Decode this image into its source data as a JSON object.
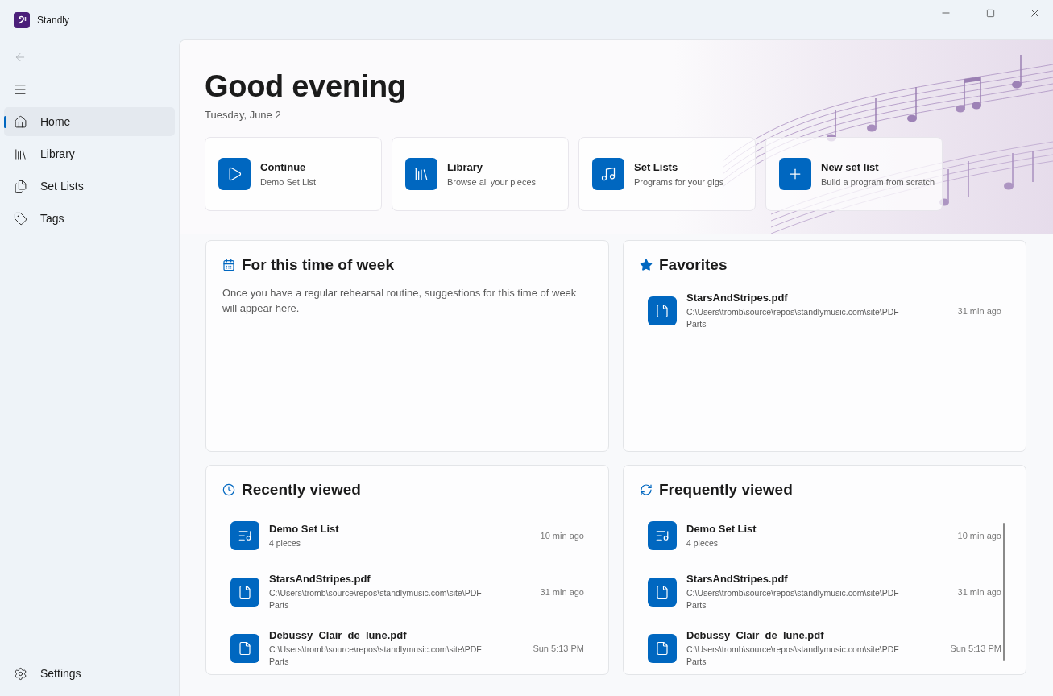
{
  "window": {
    "title": "Standly"
  },
  "nav": {
    "items": [
      {
        "label": "Home",
        "selected": true
      },
      {
        "label": "Library",
        "selected": false
      },
      {
        "label": "Set Lists",
        "selected": false
      },
      {
        "label": "Tags",
        "selected": false
      }
    ],
    "footer": {
      "label": "Settings"
    }
  },
  "hero": {
    "greeting": "Good evening",
    "date": "Tuesday, June 2",
    "actions": [
      {
        "kind": "play",
        "title": "Continue",
        "subtitle": "Demo Set List"
      },
      {
        "kind": "library",
        "title": "Library",
        "subtitle": "Browse all your pieces"
      },
      {
        "kind": "note",
        "title": "Set Lists",
        "subtitle": "Programs for your gigs"
      },
      {
        "kind": "plus",
        "title": "New set list",
        "subtitle": "Build a program from scratch"
      }
    ]
  },
  "panels": [
    {
      "kind": "calendar",
      "title": "For this time of week",
      "message": "Once you have a regular rehearsal routine, suggestions for this time of week will appear here."
    },
    {
      "kind": "star",
      "title": "Favorites",
      "items": [
        {
          "kind": "file",
          "name": "StarsAndStripes.pdf",
          "detail": "C:\\Users\\tromb\\source\\repos\\standlymusic.com\\site\\PDF Parts",
          "time": "31 min ago"
        }
      ]
    },
    {
      "kind": "clock",
      "title": "Recently viewed",
      "items": [
        {
          "kind": "setlist",
          "name": "Demo Set List",
          "detail": "4 pieces",
          "time": "10 min ago"
        },
        {
          "kind": "file",
          "name": "StarsAndStripes.pdf",
          "detail": "C:\\Users\\tromb\\source\\repos\\standlymusic.com\\site\\PDF Parts",
          "time": "31 min ago"
        },
        {
          "kind": "file",
          "name": "Debussy_Clair_de_lune.pdf",
          "detail": "C:\\Users\\tromb\\source\\repos\\standlymusic.com\\site\\PDF Parts",
          "time": "Sun 5:13 PM"
        }
      ]
    },
    {
      "kind": "repeat",
      "title": "Frequently viewed",
      "items": [
        {
          "kind": "setlist",
          "name": "Demo Set List",
          "detail": "4 pieces",
          "time": "10 min ago"
        },
        {
          "kind": "file",
          "name": "StarsAndStripes.pdf",
          "detail": "C:\\Users\\tromb\\source\\repos\\standlymusic.com\\site\\PDF Parts",
          "time": "31 min ago"
        },
        {
          "kind": "file",
          "name": "Debussy_Clair_de_lune.pdf",
          "detail": "C:\\Users\\tromb\\source\\repos\\standlymusic.com\\site\\PDF Parts",
          "time": "Sun 5:13 PM"
        }
      ]
    }
  ]
}
